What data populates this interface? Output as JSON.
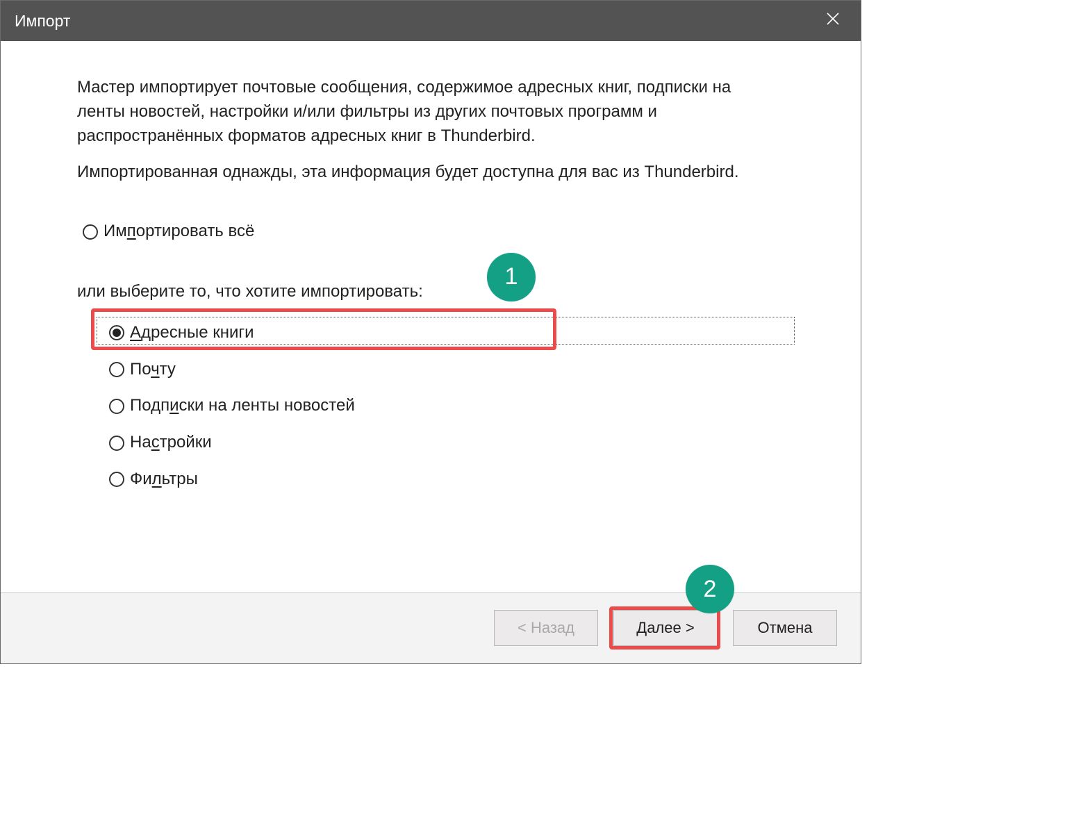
{
  "titlebar": {
    "title": "Импорт"
  },
  "content": {
    "paragraph1": "Мастер импортирует почтовые сообщения, содержимое адресных книг, подписки на ленты новостей, настройки и/или фильтры из других почтовых программ и распространённых форматов адресных книг в Thunderbird.",
    "paragraph2": "Импортированная однажды, эта информация будет доступна для вас из Thunderbird.",
    "import_all_prefix": "Им",
    "import_all_mn": "п",
    "import_all_suffix": "ортировать всё",
    "sub_prompt": "или выберите то, что хотите импортировать:",
    "options": [
      {
        "id": "address-books",
        "selected": true,
        "pre": "",
        "mn": "А",
        "post": "дресные книги"
      },
      {
        "id": "mail",
        "selected": false,
        "pre": "По",
        "mn": "ч",
        "post": "ту"
      },
      {
        "id": "feeds",
        "selected": false,
        "pre": "Подп",
        "mn": "и",
        "post": "ски на ленты новостей"
      },
      {
        "id": "settings",
        "selected": false,
        "pre": "На",
        "mn": "с",
        "post": "тройки"
      },
      {
        "id": "filters",
        "selected": false,
        "pre": "Фи",
        "mn": "л",
        "post": "ьтры"
      }
    ]
  },
  "footer": {
    "back": "< Назад",
    "next": "Далее >",
    "cancel": "Отмена"
  },
  "annotations": {
    "badge1": "1",
    "badge2": "2"
  },
  "colors": {
    "accent_badge": "#14a085",
    "highlight": "#eb4b4a",
    "titlebar_bg": "#535353"
  }
}
